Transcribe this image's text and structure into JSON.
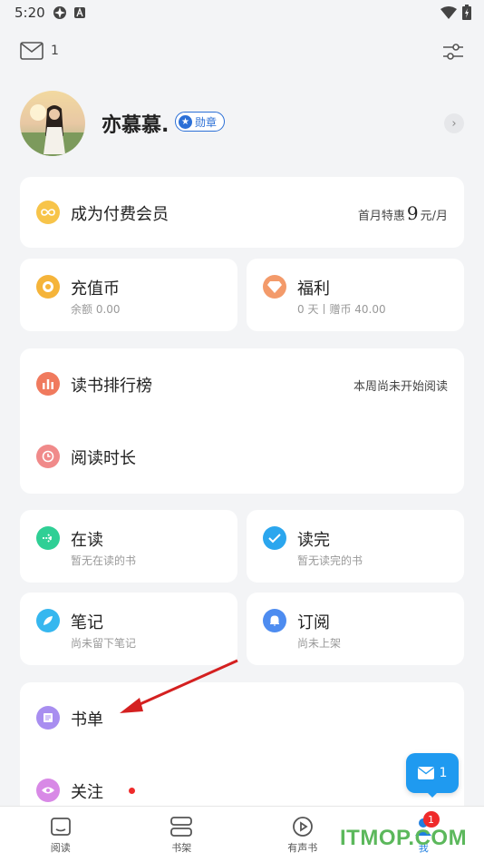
{
  "status_bar": {
    "time": "5:20"
  },
  "top_bar": {
    "mail_count": "1"
  },
  "profile": {
    "username": "亦慕慕.",
    "badge_label": "勋章"
  },
  "vip": {
    "title": "成为付费会员",
    "price_prefix": "首月特惠",
    "price_value": "9",
    "price_unit": "元/月"
  },
  "recharge": {
    "title": "充值币",
    "sub": "余额 0.00"
  },
  "welfare": {
    "title": "福利",
    "sub": "0 天丨赠币 40.00"
  },
  "ranking": {
    "title": "读书排行榜",
    "right_text": "本周尚未开始阅读"
  },
  "reading_time": {
    "title": "阅读时长"
  },
  "reading": {
    "title": "在读",
    "sub": "暂无在读的书"
  },
  "finished": {
    "title": "读完",
    "sub": "暂无读完的书"
  },
  "notes": {
    "title": "笔记",
    "sub": "尚未留下笔记"
  },
  "subscribe": {
    "title": "订阅",
    "sub": "尚未上架"
  },
  "booklist": {
    "title": "书单"
  },
  "follow": {
    "title": "关注"
  },
  "float_msg": {
    "count": "1"
  },
  "bottom_nav": {
    "items": [
      {
        "label": "阅读"
      },
      {
        "label": "书架"
      },
      {
        "label": "有声书"
      },
      {
        "label": "我",
        "badge": "1"
      }
    ]
  },
  "watermark": {
    "text_a": "ITMOP",
    "text_b": ".COM"
  },
  "colors": {
    "accent": "#1f9af0",
    "red": "#ef2b2b",
    "vip_icon": "#f7c44a"
  }
}
